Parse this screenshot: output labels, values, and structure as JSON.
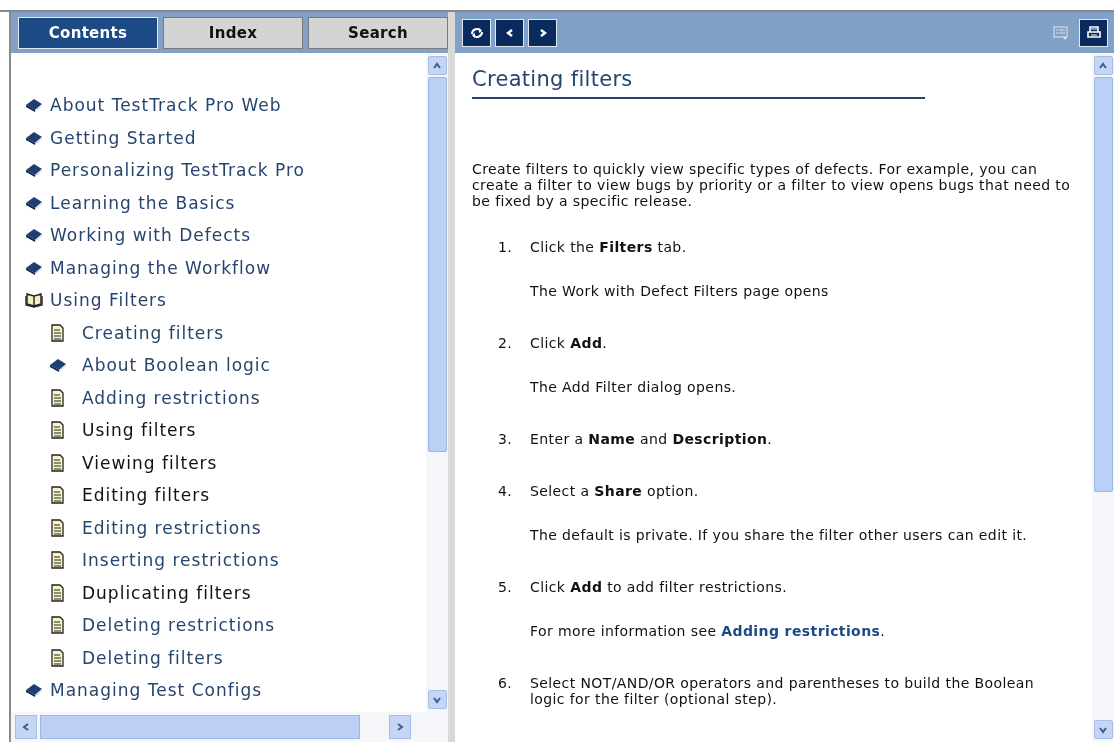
{
  "nav_tabs": [
    {
      "label": "Contents",
      "selected": true
    },
    {
      "label": "Index",
      "selected": false
    },
    {
      "label": "Search",
      "selected": false
    }
  ],
  "toolbar": {
    "buttons": [
      {
        "kind": "refresh"
      },
      {
        "kind": "previous"
      },
      {
        "kind": "next"
      }
    ],
    "right_buttons": [
      {
        "kind": "comments",
        "disabled": true
      },
      {
        "kind": "print",
        "disabled": false
      }
    ]
  },
  "tree": [
    {
      "kind": "book",
      "label": "About TestTrack Pro Web",
      "visited": false
    },
    {
      "kind": "book",
      "label": "Getting Started",
      "visited": false
    },
    {
      "kind": "book",
      "label": "Personalizing TestTrack Pro",
      "visited": false
    },
    {
      "kind": "book",
      "label": "Learning the Basics",
      "visited": false
    },
    {
      "kind": "book",
      "label": "Working with Defects",
      "visited": false
    },
    {
      "kind": "book",
      "label": "Managing the Workflow",
      "visited": false
    },
    {
      "kind": "book",
      "label": "Using Filters",
      "visited": false,
      "expanded": true,
      "children": [
        {
          "kind": "page",
          "label": "Creating filters",
          "visited": false
        },
        {
          "kind": "book",
          "label": "About Boolean logic",
          "visited": false
        },
        {
          "kind": "page",
          "label": "Adding restrictions",
          "visited": false
        },
        {
          "kind": "page",
          "label": "Using filters",
          "visited": true
        },
        {
          "kind": "page",
          "label": "Viewing filters",
          "visited": true
        },
        {
          "kind": "page",
          "label": "Editing filters",
          "visited": true
        },
        {
          "kind": "page",
          "label": "Editing restrictions",
          "visited": false
        },
        {
          "kind": "page",
          "label": "Inserting restrictions",
          "visited": false
        },
        {
          "kind": "page",
          "label": "Duplicating filters",
          "visited": true
        },
        {
          "kind": "page",
          "label": "Deleting restrictions",
          "visited": false
        },
        {
          "kind": "page",
          "label": "Deleting filters",
          "visited": false
        }
      ]
    },
    {
      "kind": "book",
      "label": "Managing Test Configs",
      "visited": false
    }
  ],
  "topic": {
    "title": "Creating filters",
    "intro": "Create filters to quickly view specific types of defects. For example, you can create a filter to view bugs by priority or a filter to view opens bugs that need to be fixed by a specific release.",
    "steps": [
      {
        "number": "1.",
        "text": "Click the **Filters** tab.",
        "note": {
          "text": "The Work with Defect Filters page opens"
        }
      },
      {
        "number": "2.",
        "text": "Click **Add**.",
        "note": {
          "text": "The Add Filter dialog opens."
        }
      },
      {
        "number": "3.",
        "text": "Enter a **Name** and **Description**."
      },
      {
        "number": "4.",
        "text": "Select a **Share** option.",
        "note": {
          "text": "The default is private. If you share the filter other users can edit it."
        }
      },
      {
        "number": "5.",
        "text": "Click **Add** to add filter restrictions.",
        "note": {
          "text": "For more information see ",
          "link": "Adding restrictions",
          "after": "."
        }
      },
      {
        "number": "6.",
        "text": "Select NOT/AND/OR operators and parentheses to build the Boolean logic for the filter (optional step)."
      }
    ]
  }
}
